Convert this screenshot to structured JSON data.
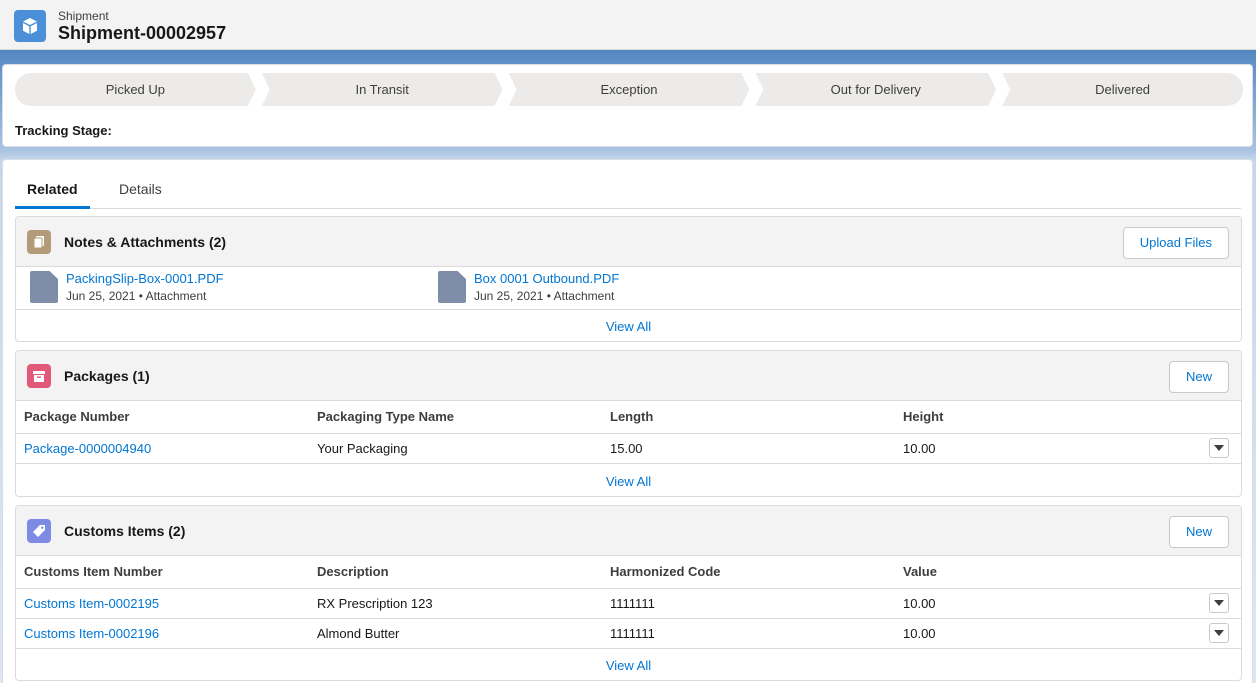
{
  "header": {
    "object_type": "Shipment",
    "record_name": "Shipment-00002957"
  },
  "path": {
    "steps": [
      "Picked Up",
      "In Transit",
      "Exception",
      "Out for Delivery",
      "Delivered"
    ],
    "tracking_label": "Tracking Stage:"
  },
  "tabs": [
    {
      "label": "Related",
      "active": true
    },
    {
      "label": "Details",
      "active": false
    }
  ],
  "notes": {
    "title": "Notes & Attachments (2)",
    "button": "Upload Files",
    "files": [
      {
        "name": "PackingSlip-Box-0001.PDF",
        "date": "Jun 25, 2021",
        "type": "Attachment"
      },
      {
        "name": "Box 0001 Outbound.PDF",
        "date": "Jun 25, 2021",
        "type": "Attachment"
      }
    ],
    "view_all": "View All"
  },
  "packages": {
    "title": "Packages (1)",
    "button": "New",
    "columns": [
      "Package Number",
      "Packaging Type Name",
      "Length",
      "Height"
    ],
    "rows": [
      {
        "number": "Package-0000004940",
        "type": "Your Packaging",
        "length": "15.00",
        "height": "10.00"
      }
    ],
    "view_all": "View All"
  },
  "customs": {
    "title": "Customs Items (2)",
    "button": "New",
    "columns": [
      "Customs Item Number",
      "Description",
      "Harmonized Code",
      "Value"
    ],
    "rows": [
      {
        "number": "Customs Item-0002195",
        "description": "RX Prescription 123",
        "code": "1111111",
        "value": "10.00"
      },
      {
        "number": "Customs Item-0002196",
        "description": "Almond Butter",
        "code": "1111111",
        "value": "10.00"
      }
    ],
    "view_all": "View All"
  },
  "colors": {
    "accent": "#0176d3",
    "shipment_icon": "#4a8fd8",
    "notes_icon": "#b39a78",
    "packages_icon": "#e3597a",
    "customs_icon": "#7e8be4"
  },
  "icons": {
    "shipment": "box-icon",
    "notes": "document-icon",
    "packages": "archive-icon",
    "customs": "tag-icon",
    "file": "attachment-file-icon",
    "row_menu": "chevron-down-icon"
  }
}
